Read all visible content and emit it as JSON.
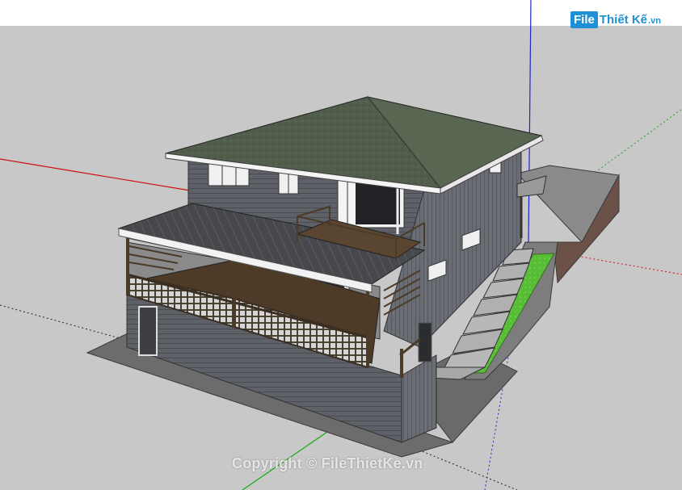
{
  "logo": {
    "badge": "File",
    "name": "Thiết Kế",
    "suffix": ".vn"
  },
  "watermark": "Copyright © FileThietKe.vn",
  "colors": {
    "sky": "#ffffff",
    "ground": "#c9c9c9",
    "siding": "#5e6066",
    "roof": "#4e5a4a",
    "deck": "#4a3a28",
    "grass": "#5cc23a",
    "axis_red": "#d11",
    "axis_green": "#1a1",
    "axis_blue": "#22c"
  }
}
